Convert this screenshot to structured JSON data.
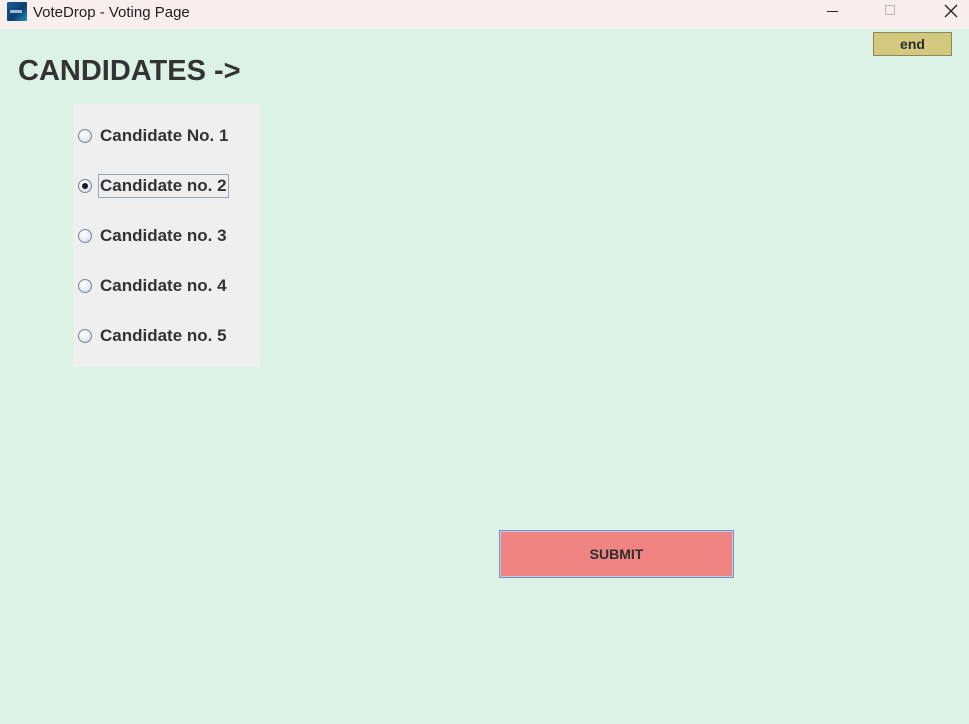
{
  "window": {
    "title": "VoteDrop - Voting Page",
    "icon": "votedrop-app-icon"
  },
  "controls": {
    "end_label": "end",
    "submit_label": "SUBMIT"
  },
  "heading": "CANDIDATES ->",
  "candidates": {
    "selected_index": 1,
    "options": [
      {
        "label": "Candidate No. 1"
      },
      {
        "label": "Candidate no. 2"
      },
      {
        "label": "Candidate no. 3"
      },
      {
        "label": "Candidate no. 4"
      },
      {
        "label": "Candidate no. 5"
      }
    ]
  },
  "colors": {
    "background": "#dcf2e4",
    "titlebar": "#f8efed",
    "panel": "#efefef",
    "end_button": "#d2c97f",
    "submit_button": "#ef8483"
  }
}
